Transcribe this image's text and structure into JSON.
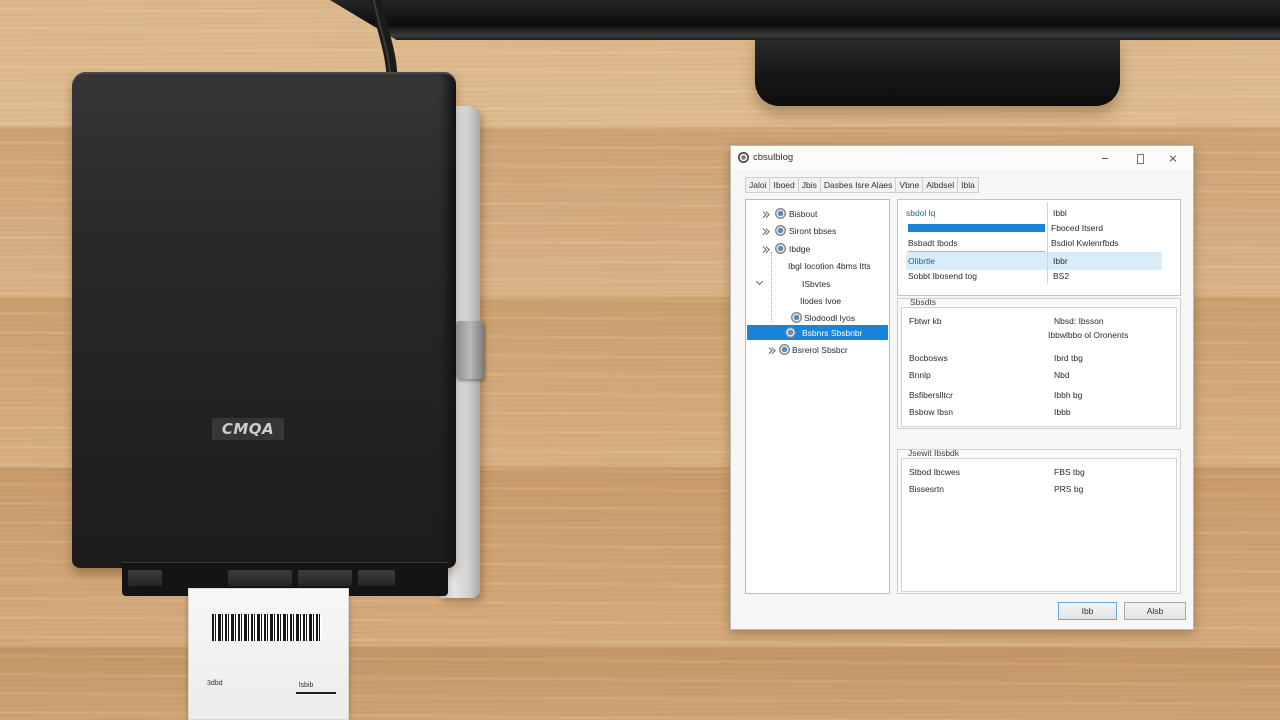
{
  "scene": {
    "printer": {
      "logo": "CMQA"
    },
    "label_paper": {
      "left_text": "3dbd",
      "right_text": "lsbib"
    },
    "colors": {
      "desk": "#d6ae80",
      "printer": "#262626",
      "monitor": "#141414"
    }
  },
  "window": {
    "title": "cbsulblog",
    "icons": {
      "app": "app-icon",
      "minimize": "minimize-icon",
      "maximize": "maximize-icon",
      "close": "close-icon"
    },
    "menu": [
      "Jaloi",
      "Iboed",
      "Jbis",
      "Dasbes Isre Alaes",
      "Vbne",
      "Albdsel",
      "Ibla"
    ],
    "tree": [
      {
        "label": "Bisbout",
        "expander": "chevron-right-icon",
        "icon": "device-icon"
      },
      {
        "label": "Siront bbses",
        "expander": "chevron-right-icon",
        "icon": "device-icon"
      },
      {
        "label": "Ibdge",
        "expander": "chevron-right-icon",
        "icon": "device-icon"
      },
      {
        "label": "Ibgl Iocotion 4bms Itts"
      },
      {
        "label": "ISbvtes",
        "expander": "chevron-down-icon"
      },
      {
        "label": "Ilodes Ivoe"
      },
      {
        "label": "Slodoodl Iyos",
        "icon": "device-icon"
      },
      {
        "label": "Bsbnrs Sbsbnbr",
        "icon": "device-icon",
        "selected": true
      },
      {
        "label": "Bsrerol Sbsbcr",
        "expander": "chevron-right-icon",
        "icon": "device-icon"
      }
    ],
    "list": [
      {
        "name": "sbdol lq",
        "value": "Ibbl"
      },
      {
        "value": "Fboced Itserd",
        "selected": true
      },
      {
        "name": "Bsbadt Ibods",
        "value": "Bsdiol Kwlenrfbds"
      },
      {
        "name": "Olibrtle",
        "value": "Ibbr",
        "highlighted": true
      },
      {
        "name": "Sobbt Ibosend tog",
        "value": "BS2"
      }
    ],
    "details": {
      "title": "Sbsdts",
      "rows": [
        {
          "name": "Fbtwr kb",
          "value": "Nbsd: Ibsson"
        },
        {
          "value": "Ibbwlbbo ol Oronents"
        },
        {
          "name": "Bocbosws",
          "value": "Ibrd tbg"
        },
        {
          "name": "Bnnlp",
          "value": "Nbd"
        },
        {
          "name": "Bsfiberslltcr",
          "value": "Ibbh bg"
        },
        {
          "name": "Bsbow Ibsn",
          "value": "Ibbb"
        }
      ]
    },
    "extra": {
      "title": "Jsewit Ibsbdk",
      "rows": [
        {
          "name": "Stbod Ibcwes",
          "value": "FBS tbg"
        },
        {
          "name": "Bissesrtn",
          "value": "PRS bg"
        }
      ]
    },
    "buttons": {
      "ok": "Ibb",
      "cancel": "Alsb"
    },
    "colors": {
      "selection": "#1a84d8",
      "highlight": "#d8ecfa",
      "accent_text": "#1f6a86"
    }
  }
}
